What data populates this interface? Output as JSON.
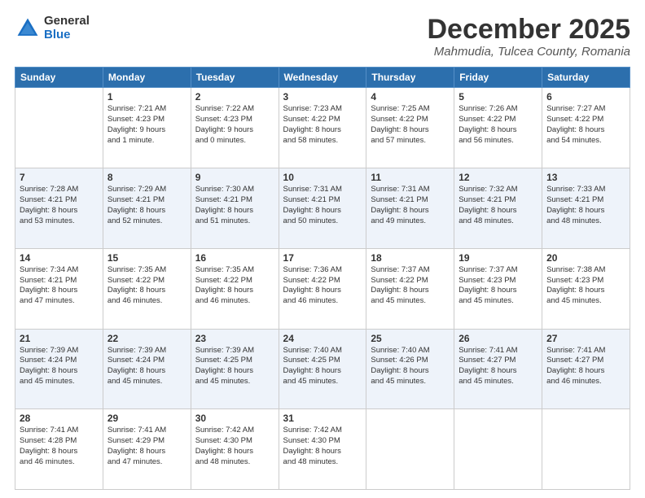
{
  "logo": {
    "general": "General",
    "blue": "Blue"
  },
  "header": {
    "month": "December 2025",
    "location": "Mahmudia, Tulcea County, Romania"
  },
  "weekdays": [
    "Sunday",
    "Monday",
    "Tuesday",
    "Wednesday",
    "Thursday",
    "Friday",
    "Saturday"
  ],
  "weeks": [
    [
      {
        "day": "",
        "info": ""
      },
      {
        "day": "1",
        "info": "Sunrise: 7:21 AM\nSunset: 4:23 PM\nDaylight: 9 hours\nand 1 minute."
      },
      {
        "day": "2",
        "info": "Sunrise: 7:22 AM\nSunset: 4:23 PM\nDaylight: 9 hours\nand 0 minutes."
      },
      {
        "day": "3",
        "info": "Sunrise: 7:23 AM\nSunset: 4:22 PM\nDaylight: 8 hours\nand 58 minutes."
      },
      {
        "day": "4",
        "info": "Sunrise: 7:25 AM\nSunset: 4:22 PM\nDaylight: 8 hours\nand 57 minutes."
      },
      {
        "day": "5",
        "info": "Sunrise: 7:26 AM\nSunset: 4:22 PM\nDaylight: 8 hours\nand 56 minutes."
      },
      {
        "day": "6",
        "info": "Sunrise: 7:27 AM\nSunset: 4:22 PM\nDaylight: 8 hours\nand 54 minutes."
      }
    ],
    [
      {
        "day": "7",
        "info": "Sunrise: 7:28 AM\nSunset: 4:21 PM\nDaylight: 8 hours\nand 53 minutes."
      },
      {
        "day": "8",
        "info": "Sunrise: 7:29 AM\nSunset: 4:21 PM\nDaylight: 8 hours\nand 52 minutes."
      },
      {
        "day": "9",
        "info": "Sunrise: 7:30 AM\nSunset: 4:21 PM\nDaylight: 8 hours\nand 51 minutes."
      },
      {
        "day": "10",
        "info": "Sunrise: 7:31 AM\nSunset: 4:21 PM\nDaylight: 8 hours\nand 50 minutes."
      },
      {
        "day": "11",
        "info": "Sunrise: 7:31 AM\nSunset: 4:21 PM\nDaylight: 8 hours\nand 49 minutes."
      },
      {
        "day": "12",
        "info": "Sunrise: 7:32 AM\nSunset: 4:21 PM\nDaylight: 8 hours\nand 48 minutes."
      },
      {
        "day": "13",
        "info": "Sunrise: 7:33 AM\nSunset: 4:21 PM\nDaylight: 8 hours\nand 48 minutes."
      }
    ],
    [
      {
        "day": "14",
        "info": "Sunrise: 7:34 AM\nSunset: 4:21 PM\nDaylight: 8 hours\nand 47 minutes."
      },
      {
        "day": "15",
        "info": "Sunrise: 7:35 AM\nSunset: 4:22 PM\nDaylight: 8 hours\nand 46 minutes."
      },
      {
        "day": "16",
        "info": "Sunrise: 7:35 AM\nSunset: 4:22 PM\nDaylight: 8 hours\nand 46 minutes."
      },
      {
        "day": "17",
        "info": "Sunrise: 7:36 AM\nSunset: 4:22 PM\nDaylight: 8 hours\nand 46 minutes."
      },
      {
        "day": "18",
        "info": "Sunrise: 7:37 AM\nSunset: 4:22 PM\nDaylight: 8 hours\nand 45 minutes."
      },
      {
        "day": "19",
        "info": "Sunrise: 7:37 AM\nSunset: 4:23 PM\nDaylight: 8 hours\nand 45 minutes."
      },
      {
        "day": "20",
        "info": "Sunrise: 7:38 AM\nSunset: 4:23 PM\nDaylight: 8 hours\nand 45 minutes."
      }
    ],
    [
      {
        "day": "21",
        "info": "Sunrise: 7:39 AM\nSunset: 4:24 PM\nDaylight: 8 hours\nand 45 minutes."
      },
      {
        "day": "22",
        "info": "Sunrise: 7:39 AM\nSunset: 4:24 PM\nDaylight: 8 hours\nand 45 minutes."
      },
      {
        "day": "23",
        "info": "Sunrise: 7:39 AM\nSunset: 4:25 PM\nDaylight: 8 hours\nand 45 minutes."
      },
      {
        "day": "24",
        "info": "Sunrise: 7:40 AM\nSunset: 4:25 PM\nDaylight: 8 hours\nand 45 minutes."
      },
      {
        "day": "25",
        "info": "Sunrise: 7:40 AM\nSunset: 4:26 PM\nDaylight: 8 hours\nand 45 minutes."
      },
      {
        "day": "26",
        "info": "Sunrise: 7:41 AM\nSunset: 4:27 PM\nDaylight: 8 hours\nand 45 minutes."
      },
      {
        "day": "27",
        "info": "Sunrise: 7:41 AM\nSunset: 4:27 PM\nDaylight: 8 hours\nand 46 minutes."
      }
    ],
    [
      {
        "day": "28",
        "info": "Sunrise: 7:41 AM\nSunset: 4:28 PM\nDaylight: 8 hours\nand 46 minutes."
      },
      {
        "day": "29",
        "info": "Sunrise: 7:41 AM\nSunset: 4:29 PM\nDaylight: 8 hours\nand 47 minutes."
      },
      {
        "day": "30",
        "info": "Sunrise: 7:42 AM\nSunset: 4:30 PM\nDaylight: 8 hours\nand 48 minutes."
      },
      {
        "day": "31",
        "info": "Sunrise: 7:42 AM\nSunset: 4:30 PM\nDaylight: 8 hours\nand 48 minutes."
      },
      {
        "day": "",
        "info": ""
      },
      {
        "day": "",
        "info": ""
      },
      {
        "day": "",
        "info": ""
      }
    ]
  ]
}
